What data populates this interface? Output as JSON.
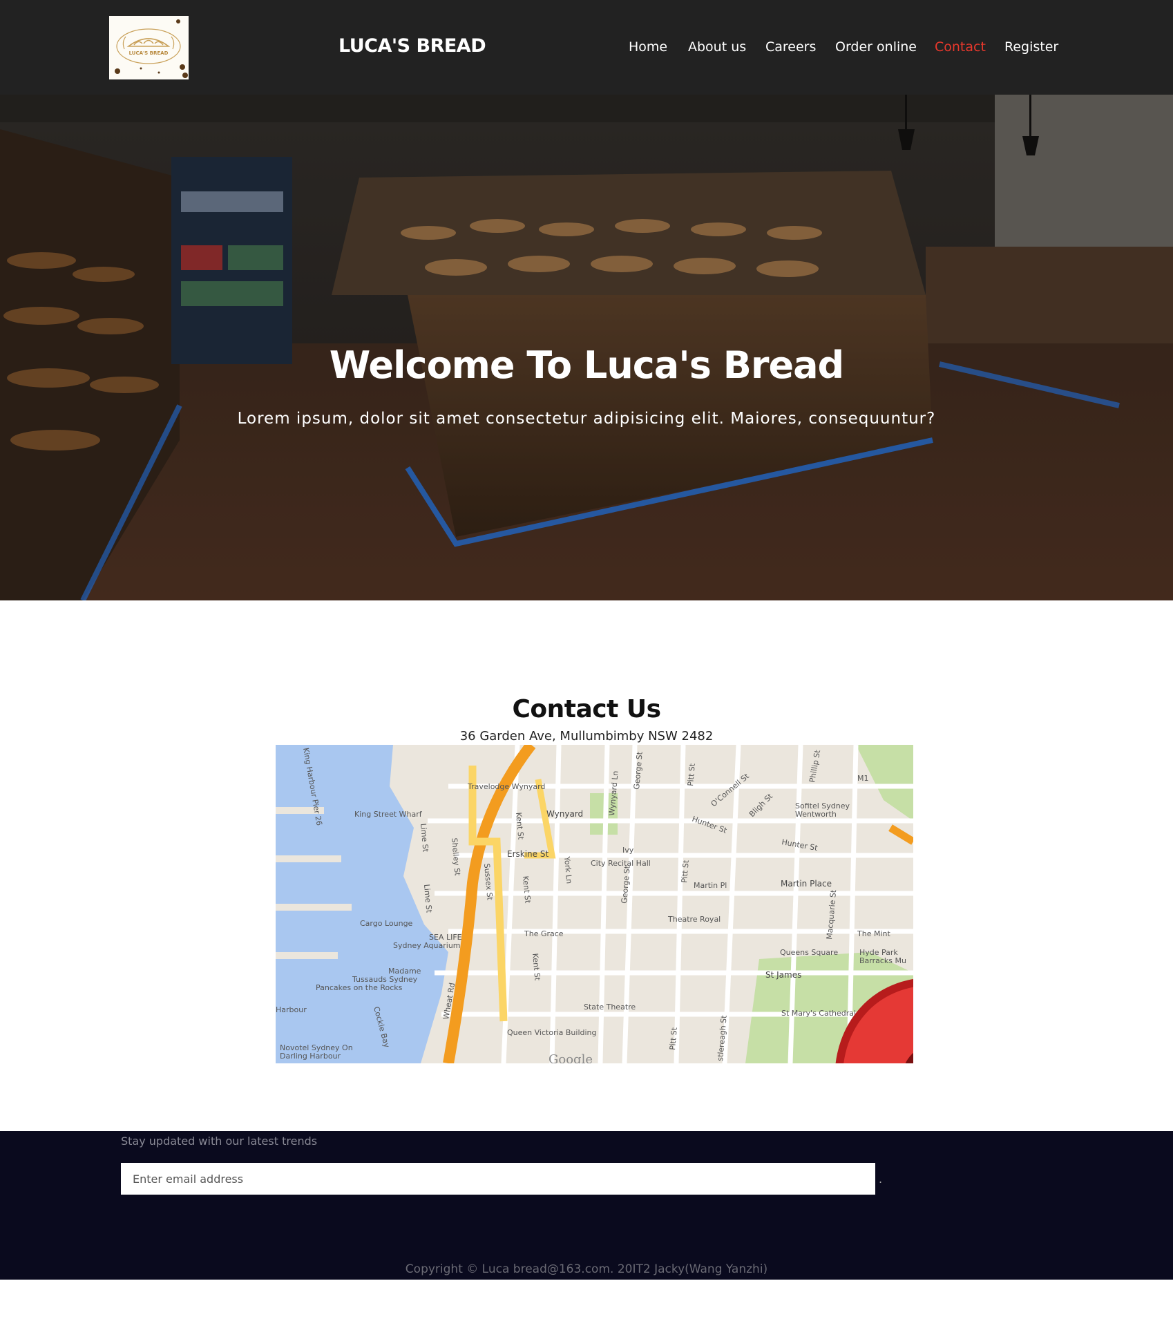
{
  "header": {
    "brand": "LUCA'S BREAD",
    "logo_text": "LUCA'S BREAD",
    "nav": [
      {
        "label": "Home"
      },
      {
        "label": "About us"
      },
      {
        "label": "Careers"
      },
      {
        "label": "Order online"
      },
      {
        "label": "Contact"
      },
      {
        "label": "Register"
      }
    ],
    "active_nav": "Contact",
    "active_color": "#e8382c"
  },
  "hero": {
    "title": "Welcome To Luca's Bread",
    "subtitle": "Lorem ipsum, dolor sit amet consectetur adipisicing elit. Maiores, consequuntur?"
  },
  "contact": {
    "title": "Contact Us",
    "address": "36 Garden Ave, Mullumbimby NSW 2482"
  },
  "map": {
    "labels": {
      "travelodge": "Travelodge Wynyard",
      "king_street_wharf": "King Street Wharf",
      "wynyard": "Wynyard",
      "erskine": "Erskine St",
      "ivy": "Ivy",
      "city_recital": "City Recital Hall",
      "sofitel": "Sofitel Sydney",
      "wentworth": "Wentworth",
      "hunter1": "Hunter St",
      "hunter2": "Hunter St",
      "martin_pl": "Martin Pl",
      "martin_place": "Martin Place",
      "cargo": "Cargo Lounge",
      "sealife": "SEA LIFE",
      "aquarium": "Sydney Aquarium",
      "the_grace": "The Grace",
      "theatre_royal": "Theatre Royal",
      "the_mint": "The Mint",
      "queens_square": "Queens Square",
      "hyde_park": "Hyde Park",
      "barracks": "Barracks Mu",
      "madame": "Madame",
      "tussauds": "Tussauds Sydney",
      "pancakes": "Pancakes on the Rocks",
      "st_james": "St James",
      "harbour": "Harbour",
      "cockle": "Cockle Bay",
      "state_theatre": "State Theatre",
      "st_marys": "St Mary's Cathedral",
      "qvb": "Queen Victoria Building",
      "novotel": "Novotel Sydney On",
      "darling": "Darling Harbour",
      "google": "Google",
      "sussex": "Sussex St",
      "kent1": "Kent St",
      "kent2": "Kent St",
      "kent3": "Kent St",
      "york": "York Ln",
      "george1": "George St",
      "george2": "George St",
      "pitt1": "Pitt St",
      "pitt2": "Pitt St",
      "pitt3": "Pitt St",
      "castlereagh": "stlereagh St",
      "macquarie": "Macquarie St",
      "phillip": "Phillip St",
      "bligh": "Bligh St",
      "oconnell": "O'Connell St",
      "shelley": "Shelley St",
      "lime1": "Lime St",
      "lime2": "Lime St",
      "wheat": "Wheat Rd",
      "wynyard_ln": "Wynyard Ln",
      "pier": "King Harbour Pier 26",
      "m1": "M1"
    }
  },
  "footer": {
    "newsletter_label": "Stay updated with our latest trends",
    "email_placeholder": "Enter email address",
    "submit_label": ".",
    "copyright": "Copyright © Luca bread@163.com.     20IT2 Jacky(Wang Yanzhi)"
  }
}
